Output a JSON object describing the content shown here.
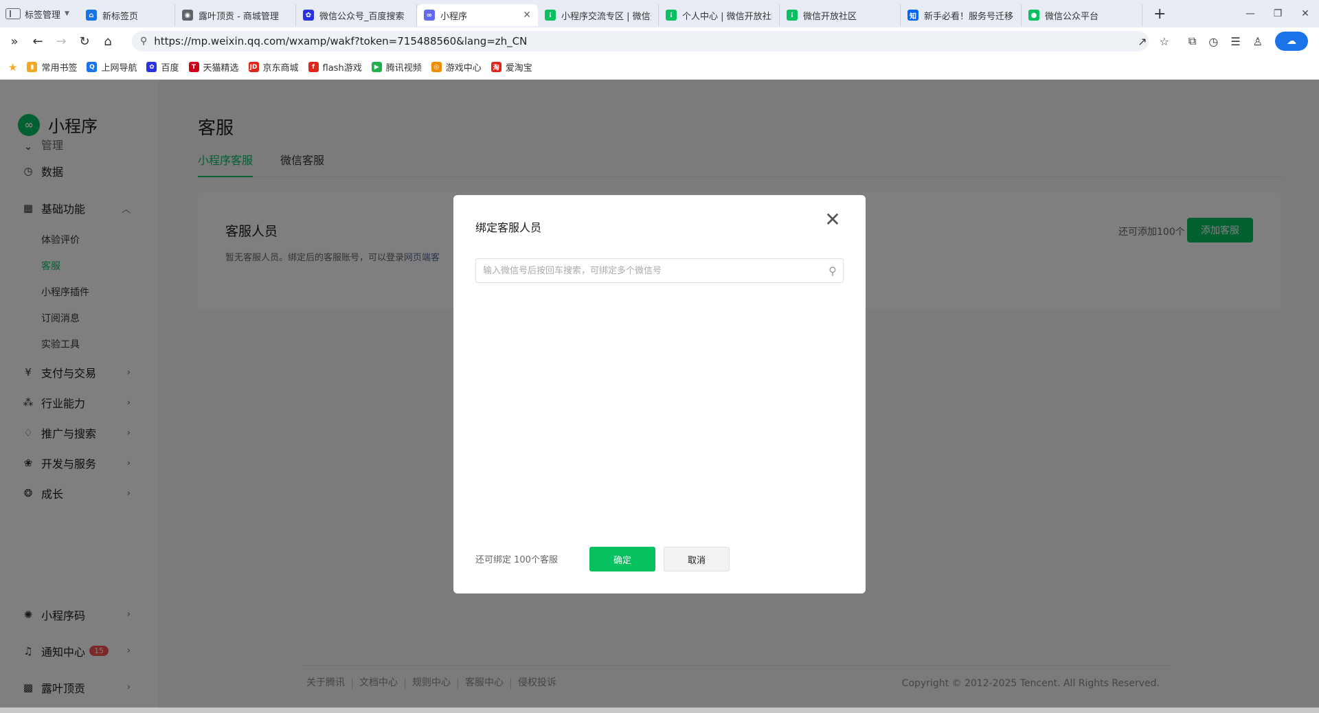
{
  "browser": {
    "tab_manager_label": "标签管理",
    "tabs": [
      {
        "label": "新标签页",
        "color": "#1a73e8",
        "glyph": "⌂"
      },
      {
        "label": "露叶顶贡 - 商城管理",
        "color": "#5f6368",
        "glyph": "◉"
      },
      {
        "label": "微信公众号_百度搜索",
        "color": "#2932e1",
        "glyph": "✿"
      },
      {
        "label": "小程序",
        "color": "#6467f0",
        "glyph": "∞",
        "active": true
      },
      {
        "label": "小程序交流专区 | 微信开放社区",
        "color": "#07c160",
        "glyph": "⁞"
      },
      {
        "label": "个人中心 | 微信开放社区",
        "color": "#07c160",
        "glyph": "⁞"
      },
      {
        "label": "微信开放社区",
        "color": "#07c160",
        "glyph": "⁞"
      },
      {
        "label": "新手必看！服务号迁移",
        "color": "#0066ff",
        "glyph": "知"
      },
      {
        "label": "微信公众平台",
        "color": "#07c160",
        "glyph": "●"
      }
    ],
    "url": "https://mp.weixin.qq.com/wxamp/wakf?token=715488560&lang=zh_CN",
    "bookmarks": [
      {
        "label": "常用书签",
        "color": "#f5a623",
        "glyph": "▮"
      },
      {
        "label": "上网导航",
        "color": "#1a73e8",
        "glyph": "Q"
      },
      {
        "label": "百度",
        "color": "#2932e1",
        "glyph": "✿"
      },
      {
        "label": "天猫精选",
        "color": "#d0021b",
        "glyph": "T"
      },
      {
        "label": "京东商城",
        "color": "#e1251b",
        "glyph": "JD"
      },
      {
        "label": "flash游戏",
        "color": "#e1251b",
        "glyph": "f"
      },
      {
        "label": "腾讯视频",
        "color": "#20b14a",
        "glyph": "▶"
      },
      {
        "label": "游戏中心",
        "color": "#f08c00",
        "glyph": "◎"
      },
      {
        "label": "爱淘宝",
        "color": "#e1251b",
        "glyph": "淘"
      }
    ]
  },
  "sidebar": {
    "logo_text": "小程序",
    "cut_item": "管理",
    "items": [
      {
        "label": "数据",
        "icon": "◷"
      },
      {
        "label": "基础功能",
        "icon": "▦",
        "expanded": true
      }
    ],
    "sub_items": [
      "体验评价",
      "客服",
      "小程序插件",
      "订阅消息",
      "实验工具"
    ],
    "more_items": [
      {
        "label": "支付与交易",
        "icon": "¥"
      },
      {
        "label": "行业能力",
        "icon": "⁂"
      },
      {
        "label": "推广与搜索",
        "icon": "♢"
      },
      {
        "label": "开发与服务",
        "icon": "❀"
      },
      {
        "label": "成长",
        "icon": "❂"
      }
    ],
    "bottom_items": [
      {
        "label": "小程序码",
        "icon": "✺"
      },
      {
        "label": "通知中心",
        "icon": "♫",
        "badge": "15"
      },
      {
        "label": "露叶顶贡",
        "icon": "▩"
      }
    ]
  },
  "main": {
    "title": "客服",
    "tabs": [
      "小程序客服",
      "微信客服"
    ],
    "panel_title": "客服人员",
    "panel_desc": "暂无客服人员。绑定后的客服账号，可以登录",
    "panel_link": "网页端客",
    "remain_text": "还可添加100个",
    "add_button": "添加客服"
  },
  "footer": {
    "links": [
      "关于腾讯",
      "文档中心",
      "规则中心",
      "客服中心",
      "侵权投诉"
    ],
    "copyright": "Copyright © 2012-2025 Tencent. All Rights Reserved."
  },
  "modal": {
    "title": "绑定客服人员",
    "search_placeholder": "输入微信号后按回车搜索，可绑定多个微信号",
    "remain_text": "还可绑定 100个客服",
    "confirm": "确定",
    "cancel": "取消"
  },
  "colors": {
    "brand_green": "#07c160",
    "link_blue": "#576b95",
    "badge_red": "#fa5151"
  }
}
